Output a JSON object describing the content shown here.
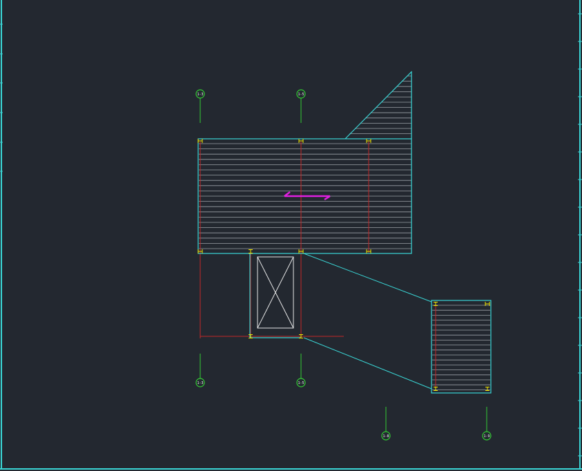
{
  "drawing": {
    "colors": {
      "background": "#232830",
      "frame": "#3ad6d6",
      "slab_outline": "#3ad6d6",
      "hatch": "#9aa0a6",
      "beam": "#c62828",
      "column": "#f2e600",
      "axis_bubble": "#33cc33",
      "arrow": "#e020e0",
      "opening": "#e6e6e6",
      "leader": "#3ad6d6"
    },
    "axis_bubbles": [
      {
        "id": "top-1",
        "label": "1-3"
      },
      {
        "id": "top-2",
        "label": "1-5"
      },
      {
        "id": "bottom-1",
        "label": "1-3"
      },
      {
        "id": "bottom-2",
        "label": "1-5"
      },
      {
        "id": "detail-1",
        "label": "1-8"
      },
      {
        "id": "detail-2",
        "label": "1-9"
      }
    ],
    "icons": {
      "span_arrow": "double-arrow-icon",
      "opening": "stair-opening-cross-icon"
    }
  }
}
